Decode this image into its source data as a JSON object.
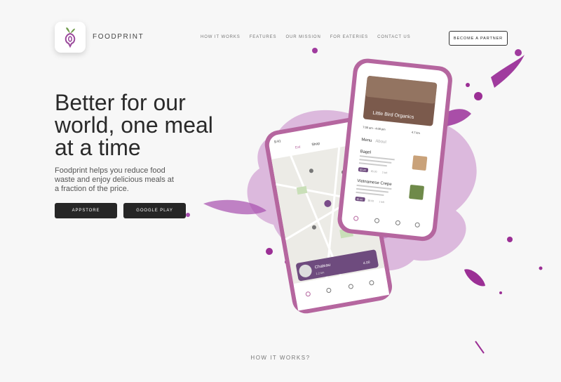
{
  "brand": {
    "name": "FOODPRINT"
  },
  "nav": {
    "items": [
      "HOW IT WORKS",
      "FEATURES",
      "OUR MISSION",
      "FOR EATERIES",
      "CONTACT US"
    ],
    "cta": "BECOME A PARTNER"
  },
  "hero": {
    "headline_lines": [
      "Better for our",
      "world, one meal",
      "at a time"
    ],
    "subtext_lines": [
      "Foodprint helps you reduce food",
      "waste and enjoy delicious meals at",
      "a fraction of the price."
    ],
    "buttons": {
      "appstore": "APPSTORE",
      "googleplay": "GOOGLE PLAY"
    }
  },
  "phone_left": {
    "status_time": "9:41",
    "filters": [
      "Eat",
      "Shop"
    ],
    "card": {
      "title": "Chateau",
      "meta": "1.2 km",
      "tag": "4.00"
    }
  },
  "phone_right": {
    "restaurant_name": "Little Bird Organics",
    "info": [
      "7:00 am - 4:00 pm",
      "4.7 km"
    ],
    "tabs": [
      "Menu",
      "About"
    ],
    "items": [
      {
        "name": "Bagel",
        "desc": "Freshly baked, this delicious bagel is topped. No extra ingredients...",
        "price": "$3.40",
        "old": "$5.00",
        "count": "2 left"
      },
      {
        "name": "Vietnamese Crepe",
        "desc": "A traditional rice flour crepe filled with greens and an assortment of fresh herbs...",
        "price": "$5.40",
        "old": "$8.00",
        "count": "1 left"
      }
    ]
  },
  "footer": {
    "how_it_works": "HOW IT WORKS?"
  },
  "colors": {
    "accent": "#9b4a9c",
    "splash": "#a64fae",
    "phone": "#b5669f",
    "dark_button": "#262626"
  }
}
